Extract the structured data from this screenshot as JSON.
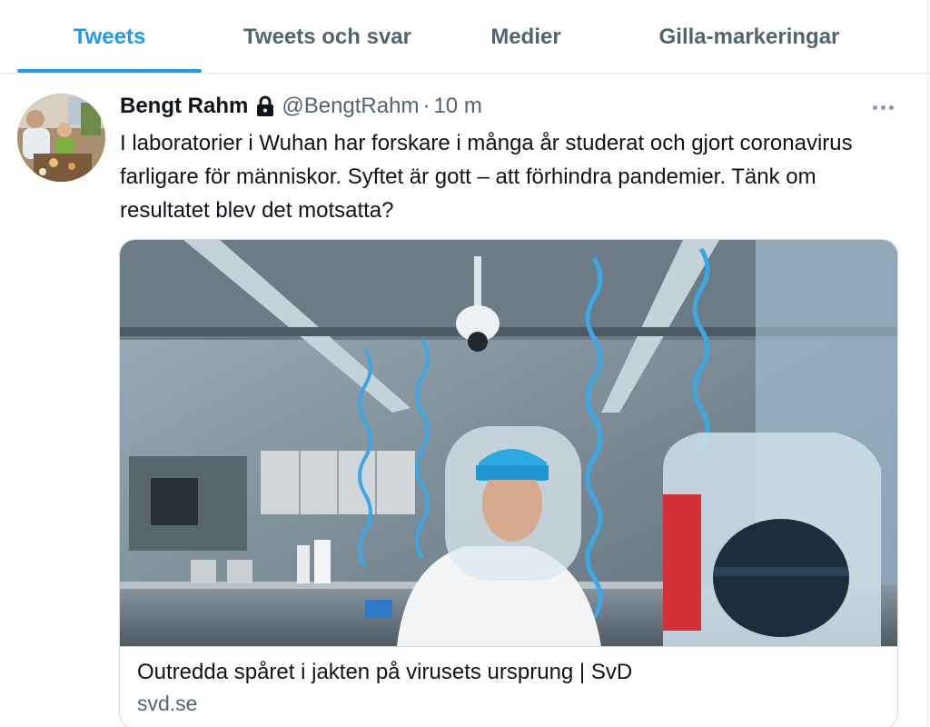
{
  "tabs": [
    {
      "label": "Tweets",
      "active": true
    },
    {
      "label": "Tweets och svar",
      "active": false
    },
    {
      "label": "Medier",
      "active": false
    },
    {
      "label": "Gilla-markeringar",
      "active": false
    }
  ],
  "tweet": {
    "author_name": "Bengt Rahm",
    "handle": "@BengtRahm",
    "separator": "·",
    "time": "10 m",
    "text": "I laboratorier i Wuhan har forskare i många år studerat och gjort coronavirus farligare för människor. Syftet är gott – att förhindra pandemier. Tänk om resultatet blev det motsatta?",
    "card": {
      "title": "Outredda spåret i jakten på virusets ursprung | SvD",
      "domain": "svd.se"
    }
  },
  "colors": {
    "accent": "#1d9bf0",
    "secondary_text": "#536471",
    "border": "#cfd9de"
  },
  "icons": [
    "lock-icon",
    "more-icon"
  ]
}
